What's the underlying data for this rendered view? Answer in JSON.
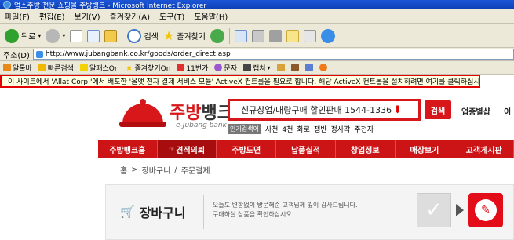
{
  "window": {
    "title": "업소주방 전문 쇼핑몰 주방뱅크 - Microsoft Internet Explorer"
  },
  "menu": [
    "파일(F)",
    "편집(E)",
    "보기(V)",
    "즐겨찾기(A)",
    "도구(T)",
    "도움말(H)"
  ],
  "toolbar": {
    "back": "뒤로",
    "search": "검색",
    "favorites": "즐겨찾기"
  },
  "address": {
    "label": "주소(D)",
    "url": "http://www.jubangbank.co.kr/goods/order_direct.asp"
  },
  "links": [
    "알툴바",
    "빠른검색",
    "알패스On",
    "즐겨찾기On",
    "11번가",
    "문자",
    "캡쳐"
  ],
  "infobar": {
    "text": "이 사이트에서 'Allat Corp.'에서 배포한 '올앳 전자 결제 서비스 모듈' ActiveX 컨트롤을 필요로 합니다. 해당 ActiveX 컨트롤을 설치하려면 여기를 클릭하십시오."
  },
  "site": {
    "brand_red": "주방",
    "brand_gray": "뱅크",
    "brand_sub": "e-Jubang bank",
    "search_text": "신규창업/대량구매 할인판매 1544-1336",
    "search_button": "검색",
    "biz_link": "업종별샵",
    "biz_link2": "이",
    "popular_label": "인기검색어",
    "popular": [
      "사천",
      "4천",
      "화로",
      "쟁반",
      "정사각",
      "주전자"
    ],
    "nav": [
      "주방뱅크홈",
      "견적의뢰",
      "주방도면",
      "납품실적",
      "창업정보",
      "매장보기",
      "고객게시판"
    ],
    "breadcrumb": [
      "홈",
      "장바구니",
      "주문결제"
    ],
    "cart_title": "장바구니",
    "cart_msg_1": "오늘도 변함없이 방문해준 고객님께 깊이 감사드립니다.",
    "cart_msg_2": "구매하실 상품을 확인하십시오."
  }
}
